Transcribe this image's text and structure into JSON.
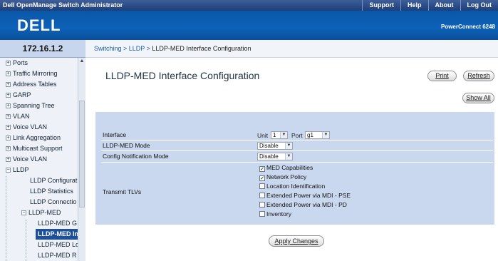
{
  "header": {
    "app_title": "Dell OpenManage Switch Administrator",
    "links": [
      "Support",
      "Help",
      "About",
      "Log Out"
    ],
    "logo": "DELL",
    "model": "PowerConnect 6248"
  },
  "ip": "172.16.1.2",
  "breadcrumb": {
    "path": "Switching > LLDP > ",
    "current": "LLDP-MED Interface Configuration"
  },
  "nav": {
    "items": [
      {
        "label": "Ports"
      },
      {
        "label": "Traffic Mirroring"
      },
      {
        "label": "Address Tables"
      },
      {
        "label": "GARP"
      },
      {
        "label": "Spanning Tree"
      },
      {
        "label": "VLAN"
      },
      {
        "label": "Voice VLAN"
      },
      {
        "label": "Link Aggregation"
      },
      {
        "label": "Multicast Support"
      },
      {
        "label": "Voice VLAN"
      },
      {
        "label": "LLDP"
      },
      {
        "label": "LLDP Configurat"
      },
      {
        "label": "LLDP Statistics"
      },
      {
        "label": "LLDP Connectio"
      },
      {
        "label": "LLDP-MED"
      },
      {
        "label": "LLDP-MED G"
      },
      {
        "label": "LLDP-MED In"
      },
      {
        "label": "LLDP-MED Lo"
      },
      {
        "label": "LLDP-MED R"
      }
    ]
  },
  "page": {
    "title": "LLDP-MED Interface Configuration",
    "print": "Print",
    "refresh": "Refresh",
    "show_all": "Show All",
    "apply": "Apply Changes"
  },
  "form": {
    "interface_label": "Interface",
    "unit_label": "Unit",
    "unit_value": "1",
    "port_label": "Port",
    "port_value": "g1",
    "mode_label": "LLDP-MED Mode",
    "mode_value": "Disable",
    "notif_label": "Config Notification Mode",
    "notif_value": "Disable",
    "tlv_label": "Transmit TLVs",
    "tlvs": [
      {
        "label": "MED Capabilities",
        "checked": true
      },
      {
        "label": "Network Policy",
        "checked": true
      },
      {
        "label": "Location Identification",
        "checked": false
      },
      {
        "label": "Extended Power via MDI - PSE",
        "checked": false
      },
      {
        "label": "Extended Power via MDI - PD",
        "checked": false
      },
      {
        "label": "Inventory",
        "checked": false
      }
    ]
  }
}
